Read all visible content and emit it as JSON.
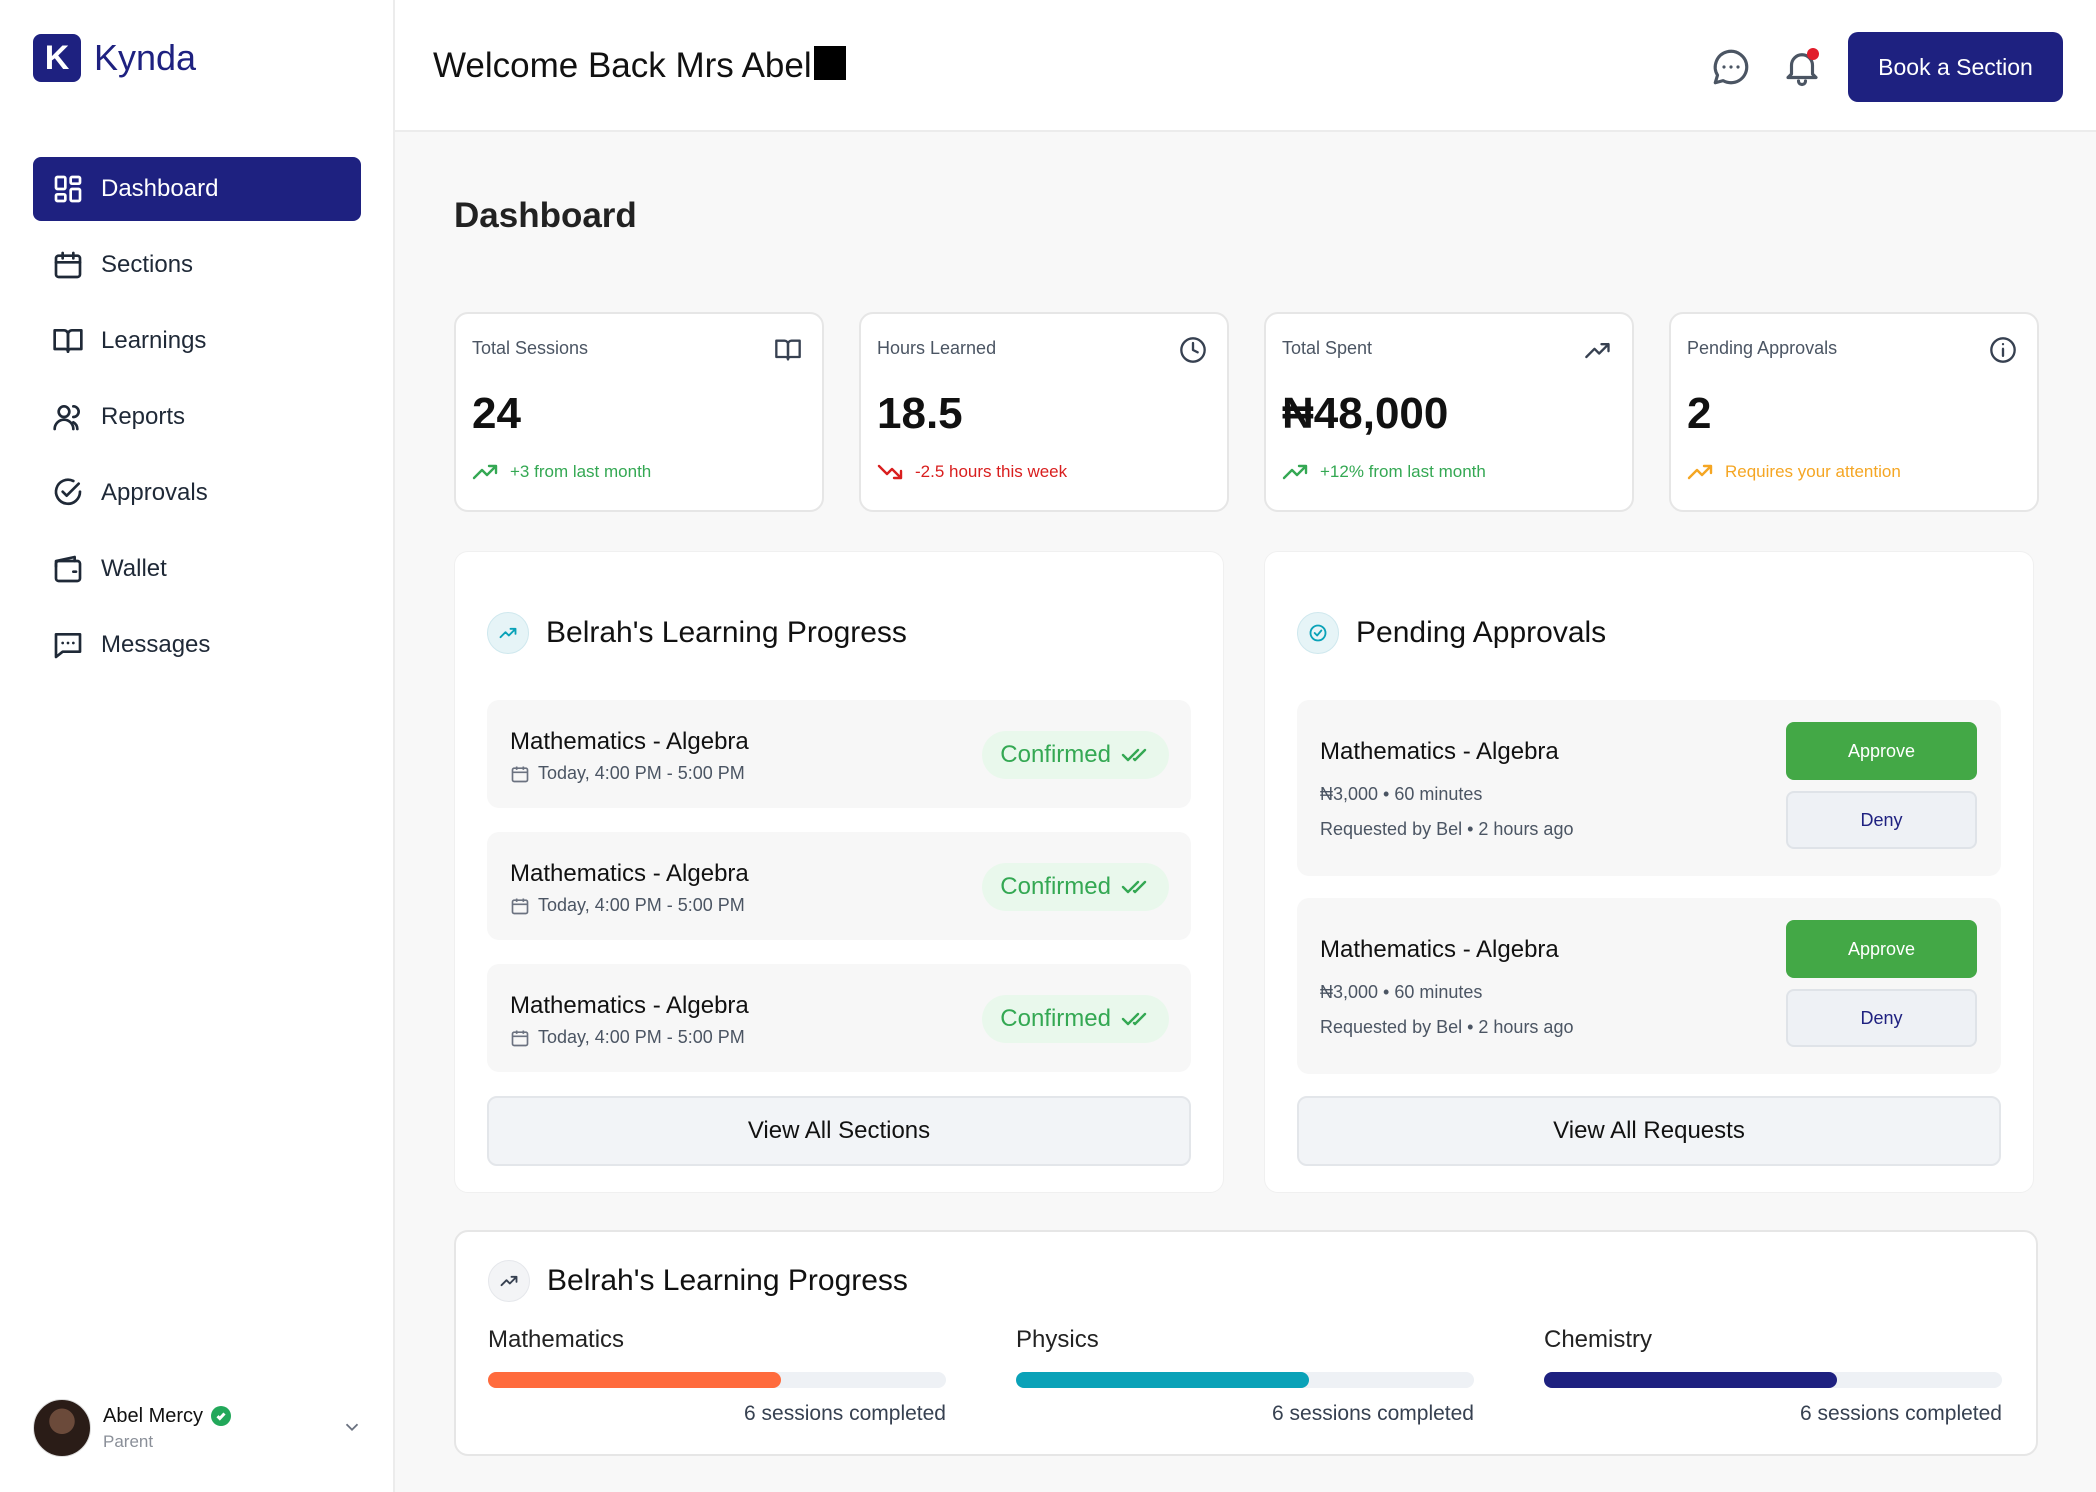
{
  "app": {
    "logo_letter": "K",
    "name": "Kynda"
  },
  "sidebar": {
    "items": [
      {
        "label": "Dashboard",
        "icon": "dashboard-icon",
        "active": true
      },
      {
        "label": "Sections",
        "icon": "calendar-icon"
      },
      {
        "label": "Learnings",
        "icon": "book-icon"
      },
      {
        "label": "Reports",
        "icon": "users-icon"
      },
      {
        "label": "Approvals",
        "icon": "check-circle-icon"
      },
      {
        "label": "Wallet",
        "icon": "wallet-icon"
      },
      {
        "label": "Messages",
        "icon": "message-icon"
      }
    ],
    "user": {
      "name": "Abel Mercy",
      "role": "Parent"
    }
  },
  "header": {
    "welcome": "Welcome Back Mrs Abel",
    "book_button": "Book a Section"
  },
  "page_title": "Dashboard",
  "stats": [
    {
      "label": "Total Sessions",
      "value": "24",
      "trend": "+3 from last month",
      "trend_color": "#34a853",
      "icon": "book-icon"
    },
    {
      "label": "Hours Learned",
      "value": "18.5",
      "trend": "-2.5 hours this week",
      "trend_color": "#d91e1e",
      "icon": "clock-icon"
    },
    {
      "label": "Total Spent",
      "value": "₦48,000",
      "trend": "+12% from last month",
      "trend_color": "#34a853",
      "icon": "trending-up-icon"
    },
    {
      "label": "Pending Approvals",
      "value": "2",
      "trend": "Requires your attention",
      "trend_color": "#f5a623",
      "icon": "info-icon"
    }
  ],
  "progress_panel": {
    "title": "Belrah's Learning Progress",
    "sessions": [
      {
        "title": "Mathematics - Algebra",
        "time": "Today, 4:00 PM - 5:00 PM",
        "status": "Confirmed"
      },
      {
        "title": "Mathematics - Algebra",
        "time": "Today, 4:00 PM - 5:00 PM",
        "status": "Confirmed"
      },
      {
        "title": "Mathematics - Algebra",
        "time": "Today, 4:00 PM - 5:00 PM",
        "status": "Confirmed"
      }
    ],
    "view_all": "View All Sections"
  },
  "approvals_panel": {
    "title": "Pending Approvals",
    "requests": [
      {
        "title": "Mathematics - Algebra",
        "meta": "₦3,000 • 60 minutes",
        "by": "Requested by Bel • 2 hours ago",
        "approve": "Approve",
        "deny": "Deny"
      },
      {
        "title": "Mathematics - Algebra",
        "meta": "₦3,000 • 60 minutes",
        "by": "Requested by Bel • 2 hours ago",
        "approve": "Approve",
        "deny": "Deny"
      }
    ],
    "view_all": "View All Requests"
  },
  "subject_progress": {
    "title": "Belrah's Learning Progress",
    "subjects": [
      {
        "name": "Mathematics",
        "progress": 0.64,
        "color": "#ff6b3d",
        "count": "6 sessions completed"
      },
      {
        "name": "Physics",
        "progress": 0.64,
        "color": "#0aa2b8",
        "count": "6 sessions completed"
      },
      {
        "name": "Chemistry",
        "progress": 0.64,
        "color": "#1e2180",
        "count": "6 sessions completed"
      }
    ]
  }
}
